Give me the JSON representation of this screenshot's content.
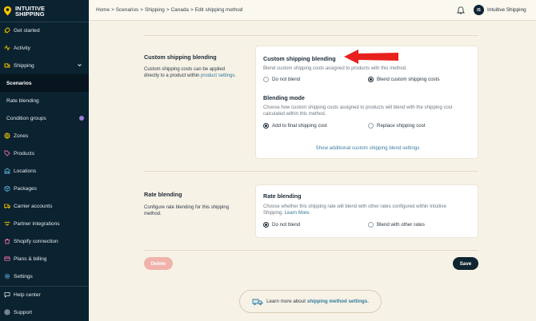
{
  "brand": {
    "line1": "INTUITIVE",
    "line2": "SHIPPING",
    "accent": "#f5c400"
  },
  "sidebar": {
    "items": [
      {
        "label": "Get started",
        "icon": "rocket-icon"
      },
      {
        "label": "Activity",
        "icon": "pulse-icon"
      },
      {
        "label": "Shipping",
        "icon": "shipping-icon"
      },
      {
        "label": "Scenarios"
      },
      {
        "label": "Rate blending"
      },
      {
        "label": "Condition groups"
      },
      {
        "label": "Zones",
        "icon": "globe-icon"
      },
      {
        "label": "Products",
        "icon": "tag-icon"
      },
      {
        "label": "Locations",
        "icon": "warehouse-icon"
      },
      {
        "label": "Packages",
        "icon": "box-icon"
      },
      {
        "label": "Carrier accounts",
        "icon": "truck-icon"
      },
      {
        "label": "Partner integrations",
        "icon": "handshake-icon"
      },
      {
        "label": "Shopify connection",
        "icon": "shopify-icon"
      },
      {
        "label": "Plans & billing",
        "icon": "card-icon"
      },
      {
        "label": "Settings",
        "icon": "gear-icon"
      },
      {
        "label": "Help center",
        "icon": "chat-icon"
      },
      {
        "label": "Support",
        "icon": "help-icon"
      }
    ]
  },
  "topbar": {
    "breadcrumb": [
      "Home",
      "Scenarios",
      "Shipping",
      "Canada",
      "Edit shipping method"
    ],
    "user_initials": "IS",
    "user_name": "Intuitive Shipping"
  },
  "custom_blending": {
    "section_title": "Custom shipping blending",
    "section_desc": "Custom shipping costs can be applied directly to a product within ",
    "section_desc_link": "product settings",
    "section_desc_end": ".",
    "card_title": "Custom shipping blending",
    "card_desc": "Blend custom shipping costs assigned to products with this method.",
    "option_off": "Do not blend",
    "option_on": "Blend custom shipping costs",
    "mode_title": "Blending mode",
    "mode_desc": "Choose how custom shipping costs assigned to products will blend with the shipping cost calculated within this method.",
    "mode_add": "Add to final shipping cost",
    "mode_replace": "Replace shipping cost",
    "show_more": "Show additional custom shipping blend settings"
  },
  "rate_blending": {
    "section_title": "Rate blending",
    "section_desc": "Configure rate blending for this shipping method.",
    "card_title": "Rate blending",
    "card_desc": "Choose whether this shipping rate will blend with other rates configured within Intuitive Shipping. ",
    "card_desc_link": "Learn More.",
    "option_off": "Do not blend",
    "option_on": "Blend with other rates"
  },
  "actions": {
    "delete_label": "Delete",
    "save_label": "Save"
  },
  "learn_more": {
    "text": "Learn more about ",
    "link": "shipping method settings."
  },
  "colors": {
    "arrow": "#e8211e",
    "sidebar_bg": "#0b2230",
    "page_bg": "#f7f2e6",
    "save_bg": "#0e2431",
    "delete_bg": "#f0b3ab"
  }
}
